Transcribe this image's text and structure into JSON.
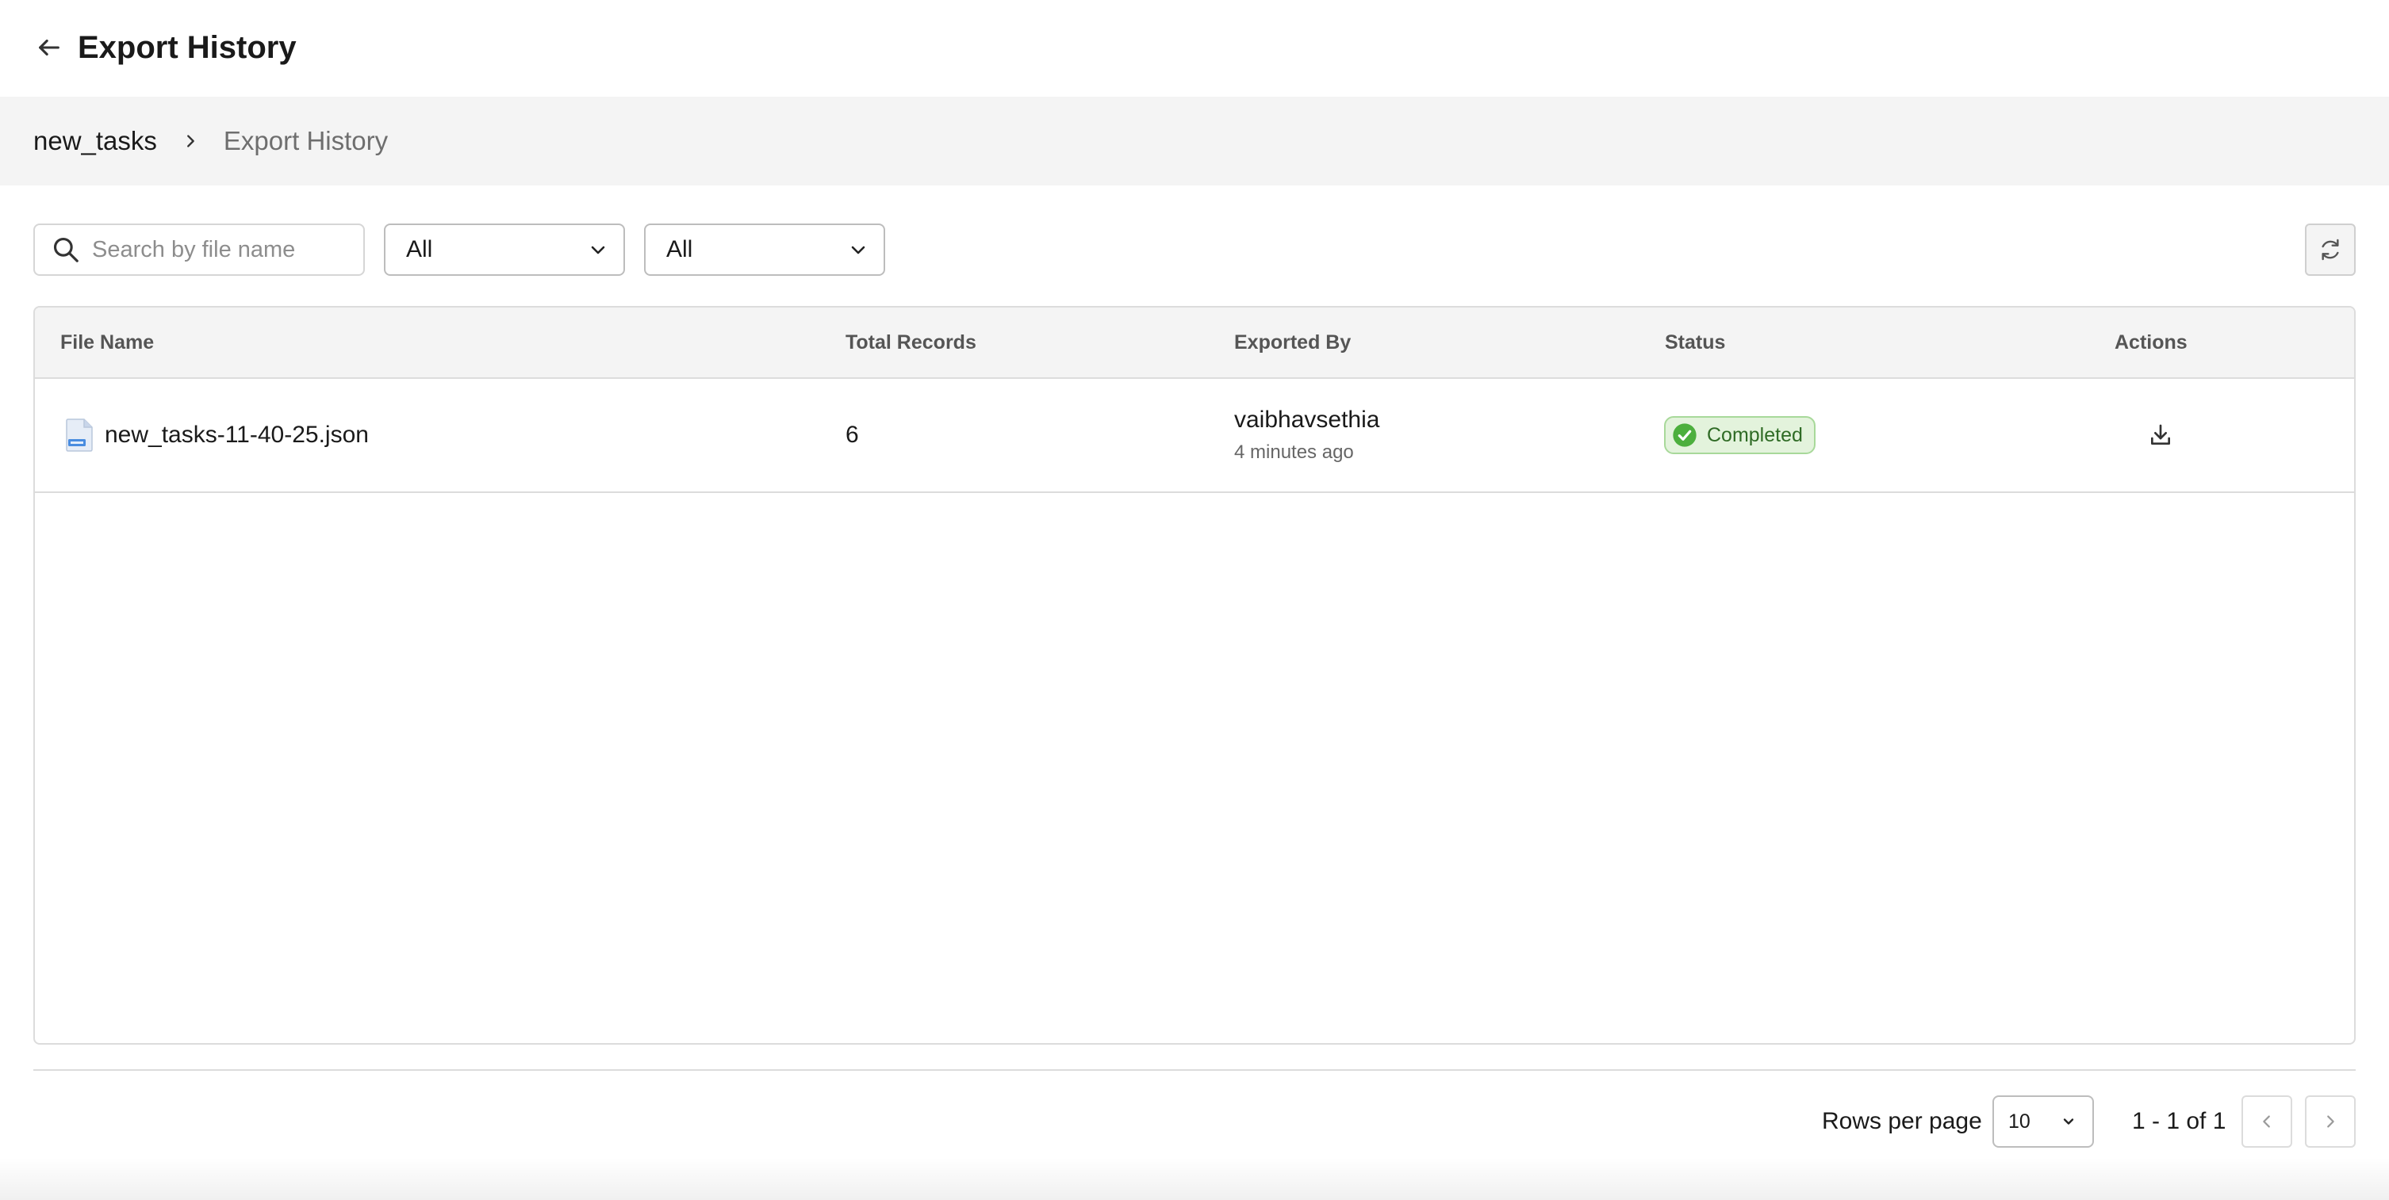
{
  "header": {
    "title": "Export History",
    "back_icon": "arrow-left-icon"
  },
  "breadcrumb": {
    "parent": "new_tasks",
    "current": "Export History"
  },
  "toolbar": {
    "search": {
      "placeholder": "Search by file name",
      "value": ""
    },
    "filter_1": {
      "value": "All"
    },
    "filter_2": {
      "value": "All"
    },
    "refresh_icon": "refresh-icon"
  },
  "table": {
    "columns": [
      "File Name",
      "Total Records",
      "Exported By",
      "Status",
      "Actions"
    ],
    "rows": [
      {
        "file_name": "new_tasks-11-40-25.json",
        "total_records": "6",
        "exported_by": "vaibhavsethia",
        "exported_at": "4 minutes ago",
        "status": "Completed",
        "action_icon": "download-icon"
      }
    ]
  },
  "pagination": {
    "rows_per_page_label": "Rows per page",
    "rows_per_page": "10",
    "range": "1 - 1 of 1"
  },
  "colors": {
    "status_bg": "#e3f3dc",
    "status_border": "#a8d99a",
    "status_text": "#2f6b25",
    "status_icon": "#4caf3d",
    "breadcrumb_bg": "#f4f4f4"
  }
}
